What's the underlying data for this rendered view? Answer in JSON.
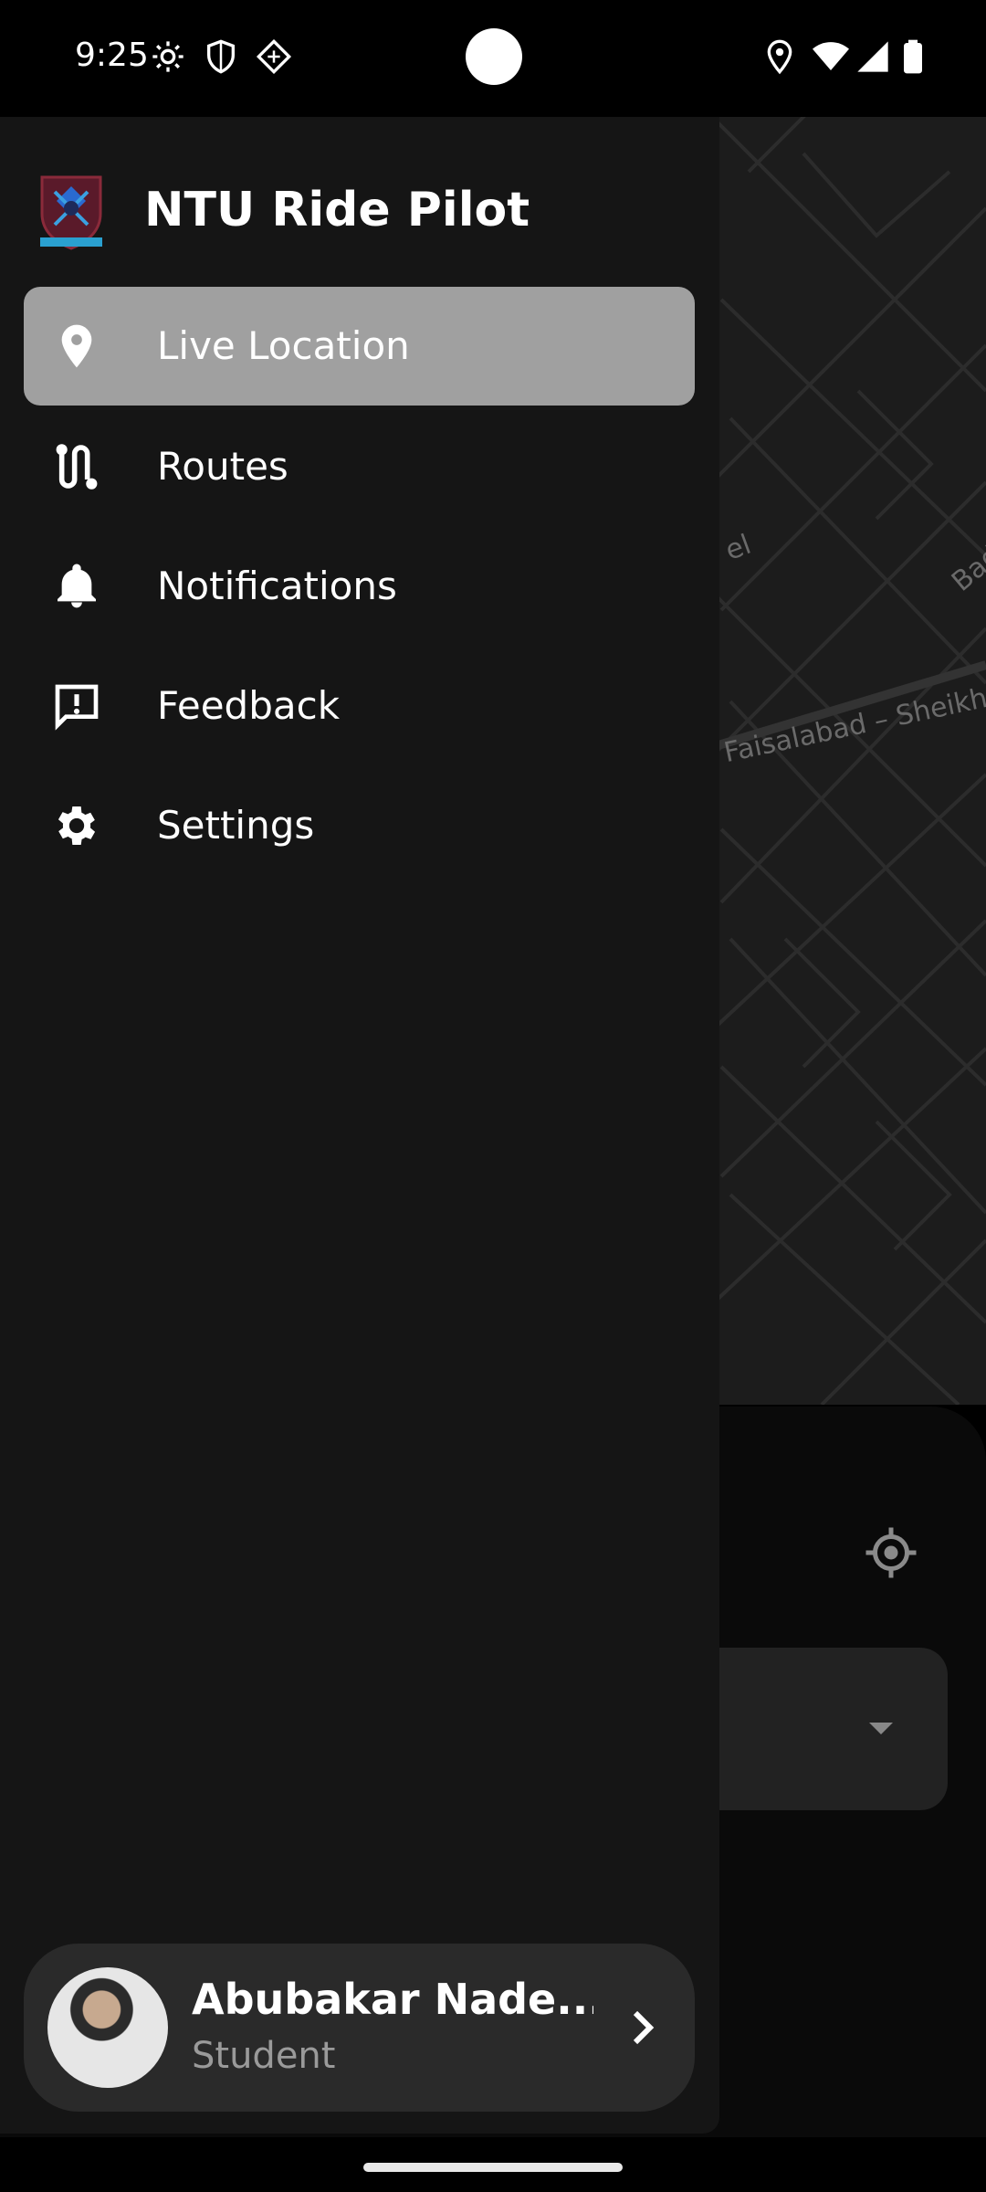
{
  "status_bar": {
    "time": "9:25"
  },
  "app": {
    "title": "NTU Ride Pilot"
  },
  "nav": {
    "items": [
      {
        "label": "Live Location",
        "icon": "location-pin-icon",
        "active": true
      },
      {
        "label": "Routes",
        "icon": "route-icon",
        "active": false
      },
      {
        "label": "Notifications",
        "icon": "bell-icon",
        "active": false
      },
      {
        "label": "Feedback",
        "icon": "feedback-icon",
        "active": false
      },
      {
        "label": "Settings",
        "icon": "gear-icon",
        "active": false
      }
    ]
  },
  "profile": {
    "name": "Abubakar Nade...",
    "role": "Student"
  },
  "map": {
    "labels": [
      "Faisalabad – Sheikh",
      "Bad",
      "el"
    ]
  },
  "colors": {
    "drawer_bg": "#151515",
    "active_item_bg": "#a0a0a0",
    "card_bg": "#2a2a2a"
  }
}
